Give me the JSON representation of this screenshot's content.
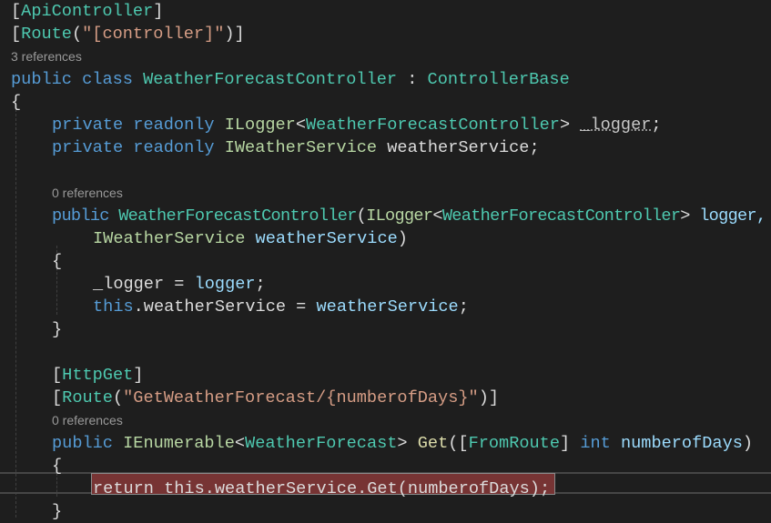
{
  "lines": [
    {
      "indent": 0,
      "tokens": [
        {
          "t": "[",
          "c": "pl"
        },
        {
          "t": "ApiController",
          "c": "ty"
        },
        {
          "t": "]",
          "c": "pl"
        }
      ]
    },
    {
      "indent": 0,
      "tokens": [
        {
          "t": "[",
          "c": "pl"
        },
        {
          "t": "Route",
          "c": "ty"
        },
        {
          "t": "(",
          "c": "pl"
        },
        {
          "t": "\"[controller]\"",
          "c": "st"
        },
        {
          "t": ")]",
          "c": "pl"
        }
      ]
    },
    {
      "indent": 0,
      "refs": "3 references"
    },
    {
      "indent": 0,
      "tokens": [
        {
          "t": "public",
          "c": "kw"
        },
        {
          "t": " ",
          "c": "pl"
        },
        {
          "t": "class",
          "c": "kw"
        },
        {
          "t": " ",
          "c": "pl"
        },
        {
          "t": "WeatherForecastController",
          "c": "ty"
        },
        {
          "t": " : ",
          "c": "pl"
        },
        {
          "t": "ControllerBase",
          "c": "ty"
        }
      ]
    },
    {
      "indent": 0,
      "tokens": [
        {
          "t": "{",
          "c": "pl"
        }
      ]
    },
    {
      "indent": 1,
      "tokens": [
        {
          "t": "private",
          "c": "kw"
        },
        {
          "t": " ",
          "c": "pl"
        },
        {
          "t": "readonly",
          "c": "kw"
        },
        {
          "t": " ",
          "c": "pl"
        },
        {
          "t": "ILogger",
          "c": "if"
        },
        {
          "t": "<",
          "c": "pl"
        },
        {
          "t": "WeatherForecastController",
          "c": "ty"
        },
        {
          "t": "> ",
          "c": "pl"
        },
        {
          "t": "_logger",
          "c": "dim"
        },
        {
          "t": ";",
          "c": "pl"
        }
      ]
    },
    {
      "indent": 1,
      "tokens": [
        {
          "t": "private",
          "c": "kw"
        },
        {
          "t": " ",
          "c": "pl"
        },
        {
          "t": "readonly",
          "c": "kw"
        },
        {
          "t": " ",
          "c": "pl"
        },
        {
          "t": "IWeatherService",
          "c": "if"
        },
        {
          "t": " weatherService;",
          "c": "pl"
        }
      ]
    },
    {
      "indent": 0,
      "tokens": []
    },
    {
      "indent": 1,
      "refs": "0 references"
    },
    {
      "indent": 1,
      "tokens": [
        {
          "t": "public",
          "c": "kw"
        },
        {
          "t": " ",
          "c": "pl"
        },
        {
          "t": "WeatherForecastController",
          "c": "ty"
        },
        {
          "t": "(",
          "c": "pl"
        },
        {
          "t": "ILogger",
          "c": "if"
        },
        {
          "t": "<",
          "c": "pl"
        },
        {
          "t": "WeatherForecastController",
          "c": "ty"
        },
        {
          "t": "> ",
          "c": "pl"
        },
        {
          "t": "logger,",
          "c": "pa"
        }
      ]
    },
    {
      "indent": 2,
      "tokens": [
        {
          "t": "IWeatherService",
          "c": "if"
        },
        {
          "t": " ",
          "c": "pl"
        },
        {
          "t": "weatherService",
          "c": "pa"
        },
        {
          "t": ")",
          "c": "pl"
        }
      ]
    },
    {
      "indent": 1,
      "tokens": [
        {
          "t": "{",
          "c": "pl"
        }
      ]
    },
    {
      "indent": 2,
      "tokens": [
        {
          "t": "_logger = ",
          "c": "pl"
        },
        {
          "t": "logger",
          "c": "pa"
        },
        {
          "t": ";",
          "c": "pl"
        }
      ]
    },
    {
      "indent": 2,
      "tokens": [
        {
          "t": "this",
          "c": "kw"
        },
        {
          "t": ".weatherService = ",
          "c": "pl"
        },
        {
          "t": "weatherService",
          "c": "pa"
        },
        {
          "t": ";",
          "c": "pl"
        }
      ]
    },
    {
      "indent": 1,
      "tokens": [
        {
          "t": "}",
          "c": "pl"
        }
      ]
    },
    {
      "indent": 0,
      "tokens": []
    },
    {
      "indent": 1,
      "tokens": [
        {
          "t": "[",
          "c": "pl"
        },
        {
          "t": "HttpGet",
          "c": "ty"
        },
        {
          "t": "]",
          "c": "pl"
        }
      ]
    },
    {
      "indent": 1,
      "tokens": [
        {
          "t": "[",
          "c": "pl"
        },
        {
          "t": "Route",
          "c": "ty"
        },
        {
          "t": "(",
          "c": "pl"
        },
        {
          "t": "\"GetWeatherForecast/{numberofDays}\"",
          "c": "st"
        },
        {
          "t": ")]",
          "c": "pl"
        }
      ]
    },
    {
      "indent": 1,
      "refs": "0 references"
    },
    {
      "indent": 1,
      "tokens": [
        {
          "t": "public",
          "c": "kw"
        },
        {
          "t": " ",
          "c": "pl"
        },
        {
          "t": "IEnumerable",
          "c": "if"
        },
        {
          "t": "<",
          "c": "pl"
        },
        {
          "t": "WeatherForecast",
          "c": "ty"
        },
        {
          "t": "> ",
          "c": "pl"
        },
        {
          "t": "Get",
          "c": "me"
        },
        {
          "t": "([",
          "c": "pl"
        },
        {
          "t": "FromRoute",
          "c": "ty"
        },
        {
          "t": "] ",
          "c": "pl"
        },
        {
          "t": "int",
          "c": "kw"
        },
        {
          "t": " ",
          "c": "pl"
        },
        {
          "t": "numberofDays",
          "c": "pa"
        },
        {
          "t": ")",
          "c": "pl"
        }
      ]
    },
    {
      "indent": 1,
      "tokens": [
        {
          "t": "{",
          "c": "pl"
        }
      ]
    },
    {
      "indent": 2,
      "tokens": [
        {
          "t": "return",
          "c": "pl"
        },
        {
          "t": " this.weatherService.Get(numberofDays);",
          "c": "pl"
        }
      ]
    },
    {
      "indent": 1,
      "tokens": [
        {
          "t": "}",
          "c": "pl"
        }
      ]
    }
  ]
}
